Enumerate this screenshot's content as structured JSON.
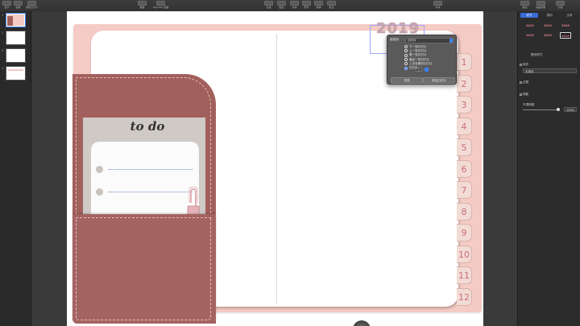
{
  "toolbar": {
    "left": [
      {
        "name": "view-button",
        "label": "显示"
      },
      {
        "name": "zoom-button",
        "label": "缩放"
      },
      {
        "name": "add-slide-button",
        "label": "添加幻灯片"
      }
    ],
    "center_left": [
      {
        "name": "play-button",
        "label": "播放"
      },
      {
        "name": "keynote-live-button",
        "label": "Keynote 直播"
      }
    ],
    "center": [
      {
        "name": "table-button",
        "label": "表格"
      },
      {
        "name": "chart-button",
        "label": "图表"
      },
      {
        "name": "text-button",
        "label": "文本"
      },
      {
        "name": "shape-button",
        "label": "形状"
      },
      {
        "name": "media-button",
        "label": "媒体"
      },
      {
        "name": "comment-button",
        "label": "批注"
      }
    ],
    "center_right": [
      {
        "name": "share-button",
        "label": "共享"
      }
    ],
    "right": [
      {
        "name": "format-button",
        "label": "格式"
      },
      {
        "name": "animate-button",
        "label": "动画效果"
      },
      {
        "name": "document-button",
        "label": "文稿"
      }
    ]
  },
  "navigator": {
    "slides": [
      {
        "number": "1",
        "selected": true
      },
      {
        "number": "2",
        "selected": false
      },
      {
        "number": "3",
        "selected": false
      },
      {
        "number": "4",
        "selected": false
      }
    ]
  },
  "slide": {
    "todo_title": "to do",
    "year": "2019",
    "tabs": [
      "1",
      "2",
      "3",
      "4",
      "5",
      "6",
      "7",
      "8",
      "9",
      "10",
      "11",
      "12"
    ]
  },
  "popover": {
    "link_label": "链接到:",
    "link_value": "幻灯片",
    "options": [
      {
        "label": "下一张幻灯片",
        "selected": false
      },
      {
        "label": "上一张幻灯片",
        "selected": false
      },
      {
        "label": "第一张幻灯片",
        "selected": false
      },
      {
        "label": "最后一张幻灯片",
        "selected": false
      },
      {
        "label": "上次查看的幻灯片",
        "selected": false
      },
      {
        "label": "幻灯片",
        "selected": true
      }
    ],
    "slide_number": "2",
    "left_button": "完成",
    "right_button": "前往幻灯片"
  },
  "inspector": {
    "tabs": [
      {
        "label": "样式",
        "active": true
      },
      {
        "label": "排列",
        "active": false
      },
      {
        "label": "文本",
        "active": false
      }
    ],
    "style_chips": [
      "2019",
      "2019",
      "2019",
      "2019",
      "2019",
      "2019"
    ],
    "shape_styles": "图形样式",
    "fill_label": "填充",
    "fill_value": "无填充",
    "border_label": "边框",
    "shadow_label": "阴影",
    "opacity_label": "不透明度",
    "opacity_value": "100%"
  },
  "colors": {
    "notebook": "#f5cbc5",
    "pocket": "#a2605d",
    "tab_text": "#cc6d80",
    "accent": "#3b82f6"
  }
}
